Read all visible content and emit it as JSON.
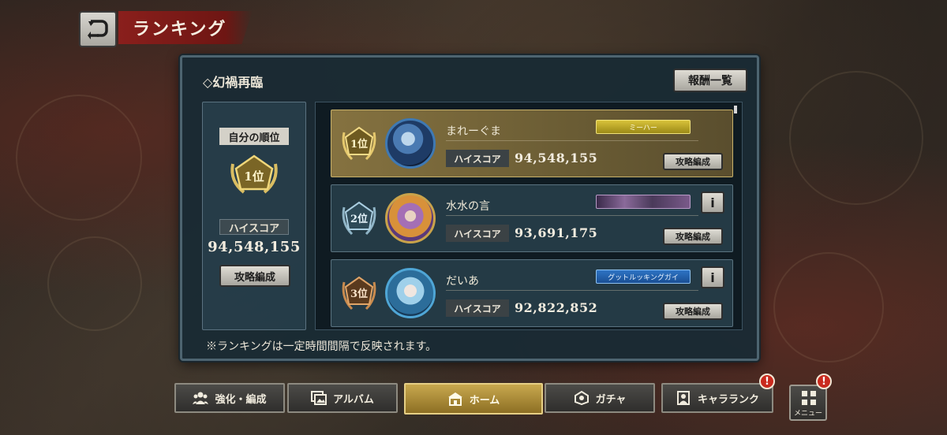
{
  "header": {
    "title": "ランキング"
  },
  "panel": {
    "event_title": "◇幻禍再臨",
    "rewards_button": "報酬一覧",
    "self": {
      "label": "自分の順位",
      "rank": "1位",
      "score_label": "ハイスコア",
      "score": "94,548,155",
      "team_button": "攻略編成"
    },
    "rows": [
      {
        "rank": "1位",
        "name": "まれーぐま",
        "title_badge": "ミーハー",
        "score_label": "ハイスコア",
        "score": "94,548,155",
        "team_button": "攻略編成"
      },
      {
        "rank": "2位",
        "name": "水水の言",
        "title_badge": "",
        "score_label": "ハイスコア",
        "score": "93,691,175",
        "team_button": "攻略編成",
        "info": "i"
      },
      {
        "rank": "3位",
        "name": "だいあ",
        "title_badge": "グットルッキングガイ",
        "score_label": "ハイスコア",
        "score": "92,822,852",
        "team_button": "攻略編成",
        "info": "i"
      }
    ],
    "note": "※ランキングは一定時間間隔で反映されます。"
  },
  "nav": {
    "items": [
      {
        "label": "強化・編成",
        "icon": "people-icon"
      },
      {
        "label": "アルバム",
        "icon": "album-icon"
      },
      {
        "label": "ホーム",
        "icon": "home-icon"
      },
      {
        "label": "ガチャ",
        "icon": "gacha-icon"
      },
      {
        "label": "キャラランク",
        "icon": "character-icon"
      }
    ],
    "menu_label": "メニュー",
    "alert_symbol": "!"
  },
  "colors": {
    "header_red": "#8a1f1c",
    "gold": "#c9b26a",
    "panel": "#182a34",
    "active_nav": "#c8a84e",
    "alert": "#c92a1e"
  }
}
